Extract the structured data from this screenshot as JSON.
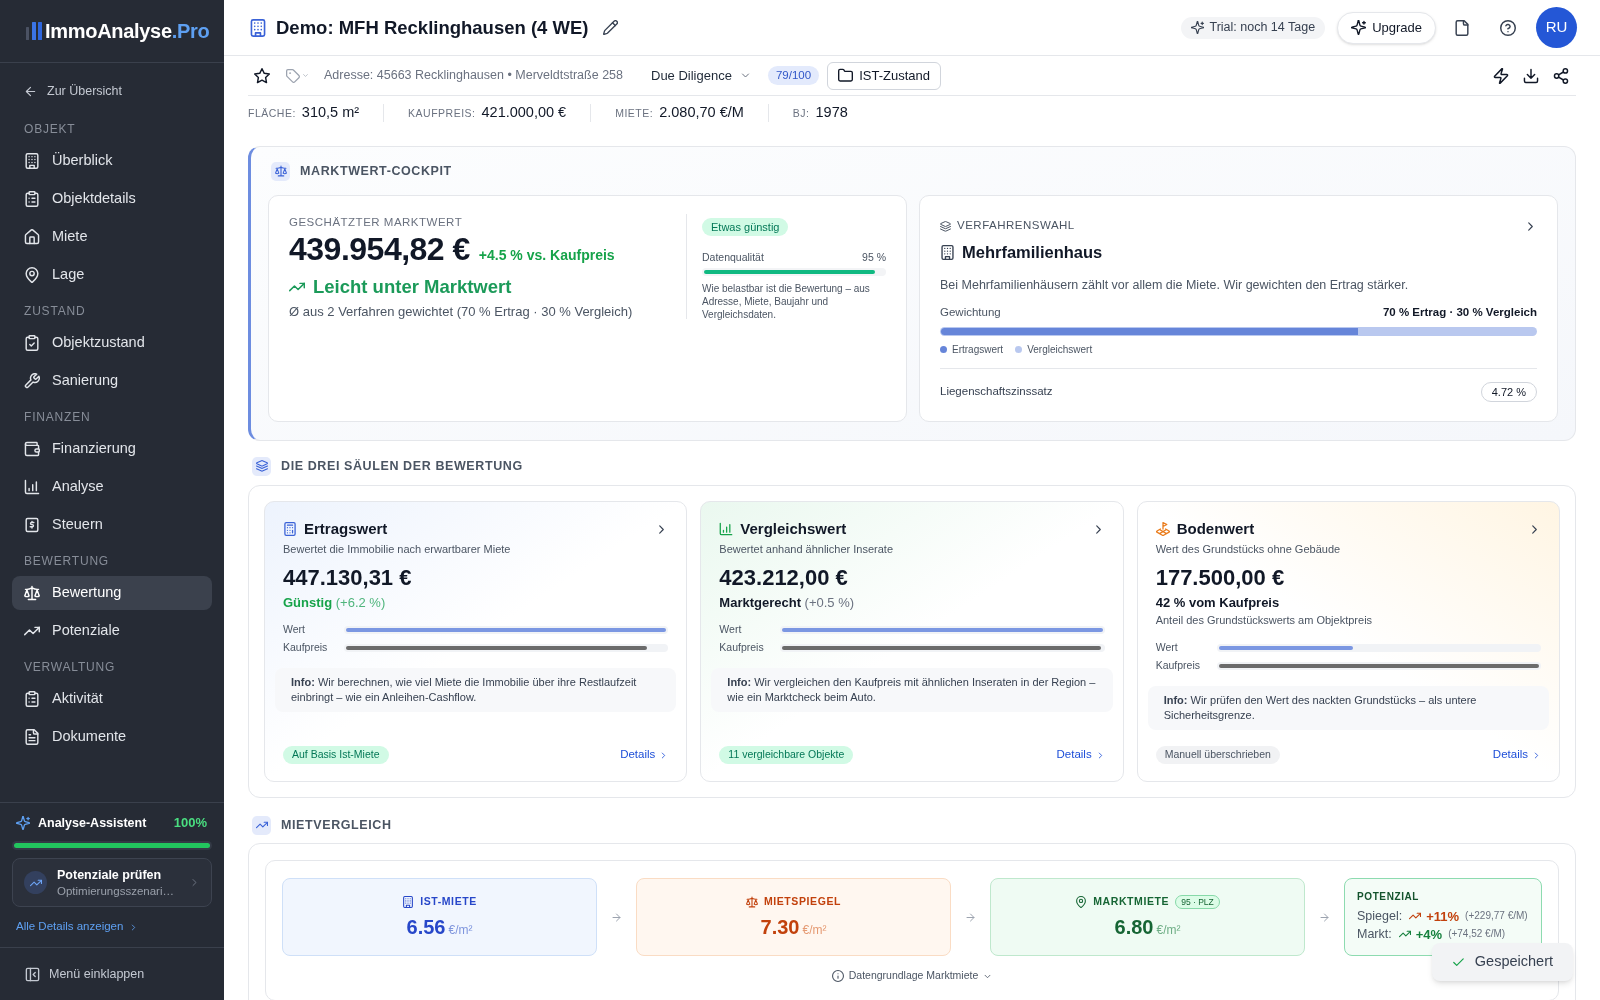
{
  "sidebar": {
    "logo": {
      "text": "ImmoAnalyse",
      "suffix": ".Pro"
    },
    "back_link": "Zur Übersicht",
    "sections": [
      {
        "title": "OBJEKT",
        "items": [
          {
            "label": "Überblick",
            "selected": false
          },
          {
            "label": "Objektdetails",
            "selected": false
          },
          {
            "label": "Miete",
            "selected": false
          },
          {
            "label": "Lage",
            "selected": false
          }
        ]
      },
      {
        "title": "ZUSTAND",
        "items": [
          {
            "label": "Objektzustand",
            "selected": false
          },
          {
            "label": "Sanierung",
            "selected": false
          }
        ]
      },
      {
        "title": "FINANZEN",
        "items": [
          {
            "label": "Finanzierung",
            "selected": false
          },
          {
            "label": "Analyse",
            "selected": false
          },
          {
            "label": "Steuern",
            "selected": false
          }
        ]
      },
      {
        "title": "BEWERTUNG",
        "items": [
          {
            "label": "Bewertung",
            "selected": true
          },
          {
            "label": "Potenziale",
            "selected": false
          }
        ]
      },
      {
        "title": "VERWALTUNG",
        "items": [
          {
            "label": "Aktivität",
            "selected": false
          },
          {
            "label": "Dokumente",
            "selected": false
          }
        ]
      }
    ],
    "assistant": {
      "title": "Analyse-Assistent",
      "reading": "100%",
      "level": 1,
      "suggestion": {
        "title": "Potenziale prüfen",
        "subtitle": "Optimierungsszenari…"
      },
      "link": "Alle Details anzeigen"
    },
    "collapse": "Menü einklappen"
  },
  "header": {
    "title": "Demo: MFH Recklinghausen (4 WE)",
    "trial": "Trial: noch 14 Tage",
    "upgrade": "Upgrade",
    "avatar": "RU"
  },
  "toolbar": {
    "favorite": false,
    "address": "Adresse: 45663 Recklinghausen • Merveldtstraße 258",
    "phase": "Due Diligence",
    "score": "79/100",
    "state": "IST-Zustand"
  },
  "facts": [
    {
      "label": "FLÄCHE:",
      "value": "310,5 m²"
    },
    {
      "label": "KAUFPREIS:",
      "value": "421.000,00 €"
    },
    {
      "label": "MIETE:",
      "value": "2.080,70 €/M"
    },
    {
      "label": "BJ:",
      "value": "1978"
    }
  ],
  "cockpit": {
    "title": "MARKTWERT-COCKPIT",
    "estimate": {
      "label": "GESCHÄTZTER MARKTWERT",
      "value": "439.954,82 €",
      "delta": "+4.5 % vs. Kaufpreis",
      "verdict": "Leicht unter Marktwert",
      "note": "Ø aus 2 Verfahren gewichtet (70 % Ertrag · 30 % Vergleich)"
    },
    "quality": {
      "badge": "Etwas günstig",
      "label": "Datenqualität",
      "reading": "95 %",
      "level": 0.95,
      "note": "Wie belastbar ist die Bewertung – aus Adresse, Miete, Baujahr und Vergleichsdaten."
    },
    "method": {
      "label": "VERFAHRENSWAHL",
      "title": "Mehrfamilienhaus",
      "description": "Bei Mehrfamilienhäusern zählt vor allem die Miete. Wir gewichten den Ertrag stärker.",
      "weighting_label": "Gewichtung",
      "weighting_reading": "70 % Ertrag · 30 % Vergleich",
      "level": 0.7,
      "legend": [
        {
          "label": "Ertragswert",
          "color": "#6685d9"
        },
        {
          "label": "Vergleichswert",
          "color": "#b9c8ef"
        }
      ],
      "rate_label": "Liegenschaftszinssatz",
      "rate": "4.72 %"
    }
  },
  "pillars": {
    "title": "DIE DREI SÄULEN DER BEWERTUNG",
    "cards": [
      {
        "kind": "income",
        "title": "Ertragswert",
        "subtitle": "Bewertet die Immobilie nach erwartbarer Miete",
        "value": "447.130,31 €",
        "status": {
          "text": "Günstig",
          "detail": "(+6.2 %)",
          "positive": true
        },
        "bars": [
          {
            "label": "Wert",
            "level": 1,
            "color": "#7b97e2"
          },
          {
            "label": "Kaufpreis",
            "level": 0.94,
            "color": "#6b6b6b"
          }
        ],
        "info": "**Info:** Wir berechnen, wie viel Miete die Immobilie über ihre Restlaufzeit einbringt – wie ein Anleihen-Cashflow.",
        "badge": {
          "text": "Auf Basis Ist-Miete",
          "positive": true
        },
        "link": "Details"
      },
      {
        "kind": "comparison",
        "title": "Vergleichswert",
        "subtitle": "Bewertet anhand ähnlicher Inserate",
        "value": "423.212,00 €",
        "status": {
          "text": "Marktgerecht",
          "detail": "(+0.5 %)",
          "positive": false
        },
        "bars": [
          {
            "label": "Wert",
            "level": 1,
            "color": "#7b97e2"
          },
          {
            "label": "Kaufpreis",
            "level": 0.995,
            "color": "#6b6b6b"
          }
        ],
        "info": "**Info:** Wir vergleichen den Kaufpreis mit ähnlichen Inseraten in der Region – wie ein Marktcheck beim Auto.",
        "badge": {
          "text": "11 vergleichbare Objekte",
          "positive": true
        },
        "link": "Details"
      },
      {
        "kind": "land",
        "title": "Bodenwert",
        "subtitle": "Wert des Grundstücks ohne Gebäude",
        "value": "177.500,00 €",
        "status": {
          "text": "42 % vom Kaufpreis",
          "positive": false
        },
        "note": "Anteil des Grundstückswerts am Objektpreis",
        "bars": [
          {
            "label": "Wert",
            "level": 0.42,
            "color": "#7b97e2"
          },
          {
            "label": "Kaufpreis",
            "level": 1,
            "color": "#6b6b6b"
          }
        ],
        "info": "**Info:** Wir prüfen den Wert des nackten Grundstücks – als untere Sicherheitsgrenze.",
        "badge": {
          "text": "Manuell überschrieben",
          "positive": false
        },
        "link": "Details"
      }
    ]
  },
  "rent_comparison": {
    "title": "MIETVERGLEICH",
    "items": [
      {
        "kind": "actual",
        "label": "IST-MIETE",
        "value": "6.56",
        "unit": "€/m²"
      },
      {
        "kind": "mirror",
        "label": "MIETSPIEGEL",
        "value": "7.30",
        "unit": "€/m²"
      },
      {
        "kind": "market",
        "label": "MARKTMIETE",
        "tag": "95 · PLZ",
        "value": "6.80",
        "unit": "€/m²"
      }
    ],
    "potential": {
      "label": "POTENZIAL",
      "rows": [
        {
          "label": "Spiegel:",
          "change": "+11%",
          "amount": "(+229,77 €/M)",
          "color": "#c2410c"
        },
        {
          "label": "Markt:",
          "change": "+4%",
          "amount": "(+74,52 €/M)",
          "color": "#15803d"
        }
      ]
    },
    "source": "Datengrundlage Marktmiete"
  },
  "toast": {
    "text": "Gespeichert"
  }
}
